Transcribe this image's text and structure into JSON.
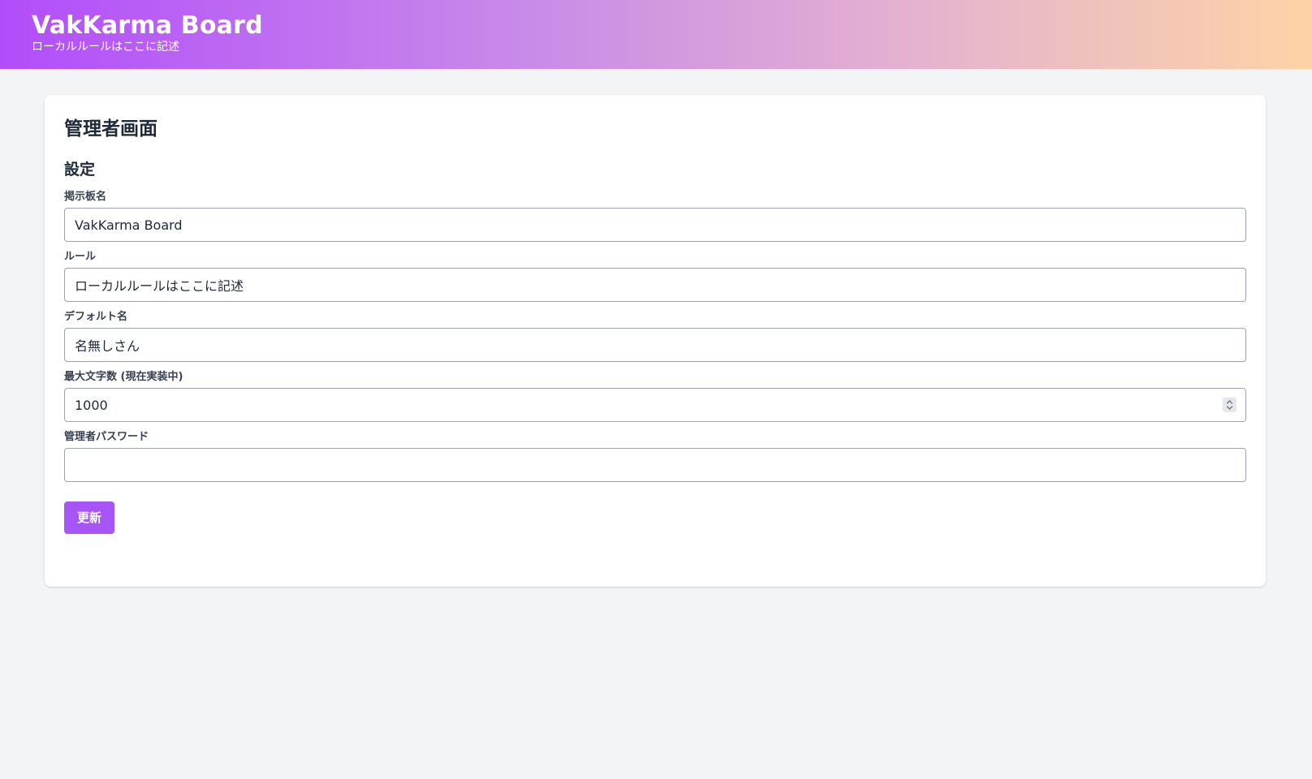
{
  "header": {
    "title": "VakKarma Board",
    "subtitle": "ローカルルールはここに記述",
    "gradient_start": "#b24dfb",
    "gradient_end": "#fdd3a6"
  },
  "admin": {
    "page_title": "管理者画面",
    "section_title": "設定",
    "fields": {
      "board_name": {
        "label": "掲示板名",
        "value": "VakKarma Board"
      },
      "rules": {
        "label": "ルール",
        "value": "ローカルルールはここに記述"
      },
      "default_name": {
        "label": "デフォルト名",
        "value": "名無しさん"
      },
      "max_chars": {
        "label": "最大文字数 (現在実装中)",
        "value": "1000"
      },
      "admin_password": {
        "label": "管理者パスワード",
        "value": ""
      }
    },
    "update_button": {
      "label": "更新",
      "color": "#a855f7"
    }
  },
  "icons": {
    "number_spinner": "up-down-chevron-icon"
  }
}
